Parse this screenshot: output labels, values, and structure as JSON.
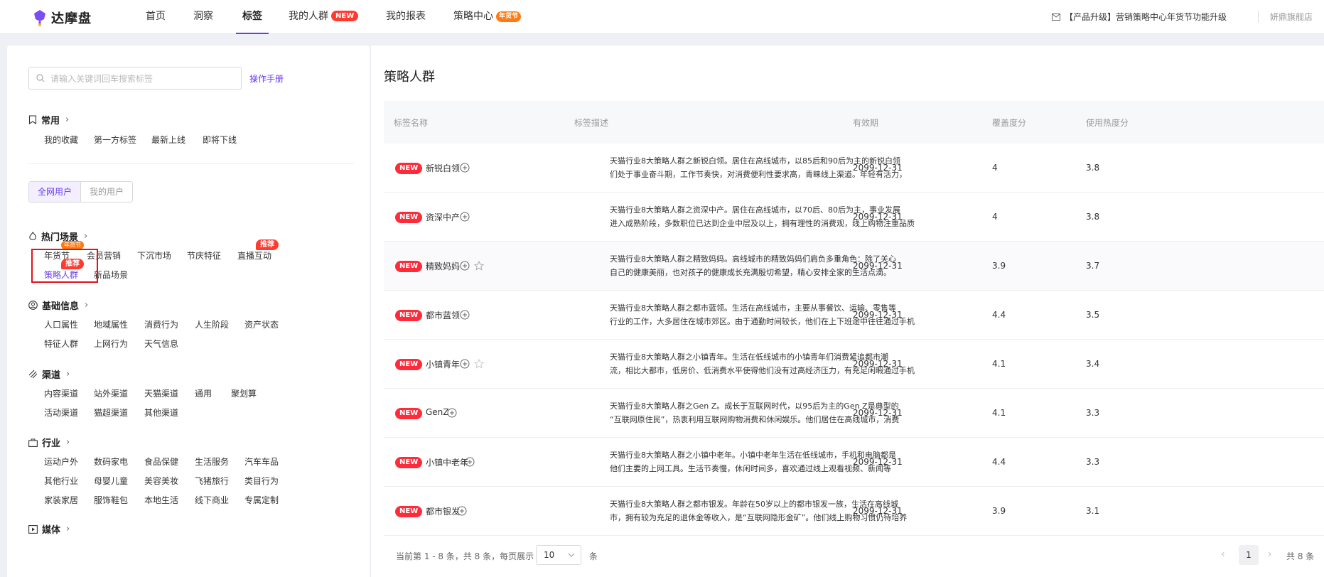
{
  "topnav": {
    "logo_text": "达摩盘",
    "items": [
      {
        "label": "首页"
      },
      {
        "label": "洞察"
      },
      {
        "label": "标签"
      },
      {
        "label": "我的人群",
        "badge": "NEW"
      },
      {
        "label": "我的报表"
      },
      {
        "label": "策略中心",
        "badge": "年货节"
      }
    ],
    "active_index": 2,
    "notice": "【产品升级】营销策略中心年货节功能升级",
    "store": "妍鼎旗舰店"
  },
  "sidebar": {
    "search_placeholder": "请输入关键词回车搜索标签",
    "manual_link": "操作手册",
    "common": {
      "title": "常用",
      "tags": [
        "我的收藏",
        "第一方标签",
        "最新上线",
        "即将下线"
      ]
    },
    "segment": {
      "options": [
        "全网用户",
        "我的用户"
      ],
      "selected": 0
    },
    "hot": {
      "title": "热门场景",
      "tags": [
        "年货节",
        "会员营销",
        "下沉市场",
        "节庆特征",
        "直播互动",
        "策略人群",
        "新品场景"
      ],
      "badge_nianhuo": "年货节",
      "badge_rec": "推荐"
    },
    "basic": {
      "title": "基础信息",
      "tags": [
        "人口属性",
        "地域属性",
        "消费行为",
        "人生阶段",
        "资产状态",
        "特征人群",
        "上网行为",
        "天气信息"
      ]
    },
    "channel": {
      "title": "渠道",
      "tags": [
        "内容渠道",
        "站外渠道",
        "天猫渠道",
        "通用",
        "聚划算",
        "活动渠道",
        "猫超渠道",
        "其他渠道"
      ]
    },
    "industry": {
      "title": "行业",
      "tags": [
        "运动户外",
        "数码家电",
        "食品保健",
        "生活服务",
        "汽车车品",
        "其他行业",
        "母婴儿童",
        "美容美妆",
        "飞猪旅行",
        "类目行为",
        "家装家居",
        "服饰鞋包",
        "本地生活",
        "线下商业",
        "专属定制"
      ]
    },
    "media": {
      "title": "媒体"
    }
  },
  "main": {
    "title": "策略人群",
    "columns": [
      "标签名称",
      "标签描述",
      "有效期",
      "覆盖度分",
      "使用热度分"
    ],
    "new_badge": "NEW",
    "rows": [
      {
        "name": "新锐白领",
        "desc1": "天猫行业8大策略人群之新锐白领。居住在高线城市，以85后和90后为主的新锐白领",
        "desc2": "们处于事业奋斗期，工作节奏快，对消费便利性要求高，青睐线上渠道。年轻有活力，",
        "expiry": "2099-12-31",
        "coverage": "4",
        "heat": "3.8"
      },
      {
        "name": "资深中产",
        "desc1": "天猫行业8大策略人群之资深中产。居住在高线城市，以70后、80后为主，事业发展",
        "desc2": "进入成熟阶段，多数职位已达到企业中层及以上，拥有理性的消费观，线上购物注重品质",
        "expiry": "2099-12-31",
        "coverage": "4",
        "heat": "3.8"
      },
      {
        "name": "精致妈妈",
        "desc1": "天猫行业8大策略人群之精致妈妈。高线城市的精致妈妈们肩负多重角色：除了关心",
        "desc2": "自己的健康美丽，也对孩子的健康成长充满殷切希望，精心安排全家的生活点滴。",
        "expiry": "2099-12-31",
        "coverage": "3.9",
        "heat": "3.7"
      },
      {
        "name": "都市蓝领",
        "desc1": "天猫行业8大策略人群之都市蓝领。生活在高线城市，主要从事餐饮、运输、零售等",
        "desc2": "行业的工作，大多居住在城市郊区。由于通勤时间较长，他们在上下班途中往往通过手机",
        "expiry": "2099-12-31",
        "coverage": "4.4",
        "heat": "3.5"
      },
      {
        "name": "小镇青年",
        "desc1": "天猫行业8大策略人群之小镇青年。生活在低线城市的小镇青年们消费紧追都市潮",
        "desc2": "流，相比大都市，低房价、低消费水平使得他们没有过高经济压力，有充足闲暇通过手机",
        "expiry": "2099-12-31",
        "coverage": "4.1",
        "heat": "3.4"
      },
      {
        "name": "GenZ",
        "desc1": "天猫行业8大策略人群之Gen Z。成长于互联网时代，以95后为主的Gen Z是典型的",
        "desc2": "“互联网原住民”，热衷利用互联网购物消费和休闲娱乐。他们居住在高线城市，消费",
        "expiry": "2099-12-31",
        "coverage": "4.1",
        "heat": "3.3"
      },
      {
        "name": "小镇中老年",
        "desc1": "天猫行业8大策略人群之小镇中老年。小镇中老年生活在低线城市，手机和电脑都是",
        "desc2": "他们主要的上网工具。生活节奏慢，休闲时间多，喜欢通过线上观看视频、新闻等",
        "expiry": "2099-12-31",
        "coverage": "4.4",
        "heat": "3.3"
      },
      {
        "name": "都市银发",
        "desc1": "天猫行业8大策略人群之都市银发。年龄在50岁以上的都市银发一族，生活在高线城",
        "desc2": "市，拥有较为充足的退休金等收入，是“互联网隐形金矿”。他们线上购物习惯仍待培养",
        "expiry": "2099-12-31",
        "coverage": "3.9",
        "heat": "3.1"
      }
    ],
    "pager": {
      "summary": "当前第 1 - 8 条，共 8 条，每页展示",
      "page_size": "10",
      "unit": "条",
      "current": "1",
      "total": "共 8 条"
    }
  },
  "colors": {
    "accent": "#6a3de8",
    "new": "#ff2b3a",
    "festival": "#ff7a12"
  }
}
